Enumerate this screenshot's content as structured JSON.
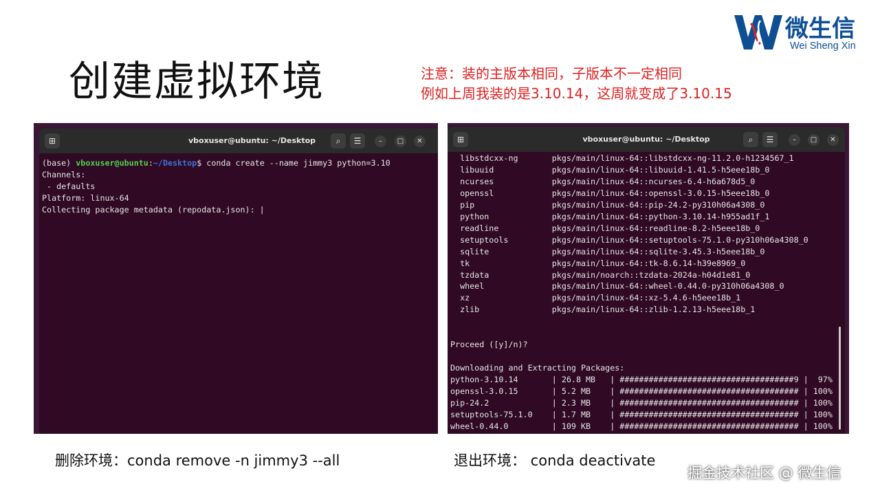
{
  "slide": {
    "title": "创建虚拟环境",
    "note_line1": "注意：装的主版本相同，子版本不一定相同",
    "note_line2": "例如上周我装的是3.10.14，这周就变成了3.10.15",
    "bottom_left": "删除环境：conda remove -n jimmy3 --all",
    "bottom_right": "退出环境：  conda deactivate",
    "watermark": "掘金技术社区 @ 微生信"
  },
  "logo": {
    "cn": "微生信",
    "en": "Wei Sheng Xin"
  },
  "colors": {
    "note": "#e02020",
    "logo": "#0e4f94",
    "terminal_bg": "#300a24",
    "prompt_user": "#4ed14e",
    "prompt_path": "#3d72d4"
  },
  "terminal_left": {
    "title": "vboxuser@ubuntu: ~/Desktop",
    "icons": [
      "new-tab-icon",
      "search-icon",
      "menu-icon",
      "minimize-icon",
      "maximize-icon",
      "close-icon"
    ],
    "prompt_env": "(base) ",
    "prompt_user": "vboxuser@ubuntu",
    "prompt_colon": ":",
    "prompt_path": "~/Desktop",
    "prompt_cmd": "$ conda create --name jimmy3 python=3.10",
    "lines": [
      "Channels:",
      " - defaults",
      "Platform: linux-64",
      "Collecting package metadata (repodata.json): |"
    ]
  },
  "terminal_right": {
    "title": "vboxuser@ubuntu: ~/Desktop",
    "icons": [
      "new-tab-icon",
      "search-icon",
      "menu-icon",
      "minimize-icon",
      "maximize-icon",
      "close-icon"
    ],
    "packages": [
      {
        "name": "libstdcxx-ng",
        "source": "pkgs/main/linux-64::libstdcxx-ng-11.2.0-h1234567_1"
      },
      {
        "name": "libuuid",
        "source": "pkgs/main/linux-64::libuuid-1.41.5-h5eee18b_0"
      },
      {
        "name": "ncurses",
        "source": "pkgs/main/linux-64::ncurses-6.4-h6a678d5_0"
      },
      {
        "name": "openssl",
        "source": "pkgs/main/linux-64::openssl-3.0.15-h5eee18b_0"
      },
      {
        "name": "pip",
        "source": "pkgs/main/linux-64::pip-24.2-py310h06a4308_0"
      },
      {
        "name": "python",
        "source": "pkgs/main/linux-64::python-3.10.14-h955ad1f_1"
      },
      {
        "name": "readline",
        "source": "pkgs/main/linux-64::readline-8.2-h5eee18b_0"
      },
      {
        "name": "setuptools",
        "source": "pkgs/main/linux-64::setuptools-75.1.0-py310h06a4308_0"
      },
      {
        "name": "sqlite",
        "source": "pkgs/main/linux-64::sqlite-3.45.3-h5eee18b_0"
      },
      {
        "name": "tk",
        "source": "pkgs/main/linux-64::tk-8.6.14-h39e8969_0"
      },
      {
        "name": "tzdata",
        "source": "pkgs/main/noarch::tzdata-2024a-h04d1e81_0"
      },
      {
        "name": "wheel",
        "source": "pkgs/main/linux-64::wheel-0.44.0-py310h06a4308_0"
      },
      {
        "name": "xz",
        "source": "pkgs/main/linux-64::xz-5.4.6-h5eee18b_1"
      },
      {
        "name": "zlib",
        "source": "pkgs/main/linux-64::zlib-1.2.13-h5eee18b_1"
      }
    ],
    "proceed": "Proceed ([y]/n)?",
    "downloading_header": "Downloading and Extracting Packages:",
    "downloads": [
      {
        "name": "python-3.10.14",
        "size": "26.8 MB",
        "bar": "####################################9",
        "pct": "97%"
      },
      {
        "name": "openssl-3.0.15",
        "size": "5.2 MB",
        "bar": "#####################################",
        "pct": "100%"
      },
      {
        "name": "pip-24.2",
        "size": "2.3 MB",
        "bar": "#####################################",
        "pct": "100%"
      },
      {
        "name": "setuptools-75.1.0",
        "size": "1.7 MB",
        "bar": "#####################################",
        "pct": "100%"
      },
      {
        "name": "wheel-0.44.0",
        "size": "109 KB",
        "bar": "#####################################",
        "pct": "100%"
      }
    ]
  }
}
